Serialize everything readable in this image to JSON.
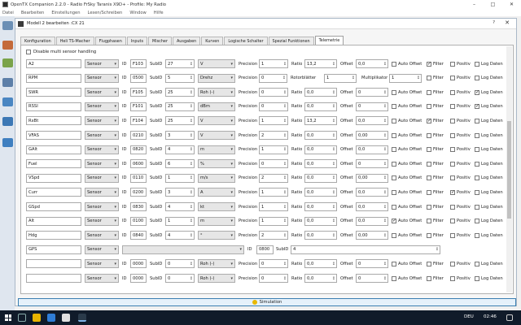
{
  "window": {
    "title": "OpenTX Companion 2.2.0 - Radio FrSky Taranis X9D+ - Profile: My Radio"
  },
  "menu": [
    "Datei",
    "Bearbeiten",
    "Einstellungen",
    "Lesen/Schreiben",
    "Window",
    "Hilfe"
  ],
  "dialog": {
    "title": "Modell 2 bearbeiten :CX 21",
    "help": "?",
    "close": "✕"
  },
  "tabs": [
    "Konfiguration",
    "Heli TS-Macher",
    "Flugphasen",
    "Inputs",
    "Mischer",
    "Ausgaben",
    "Kurven",
    "Logische Schalter",
    "Spezial Funktionen",
    "Telemetrie"
  ],
  "active_tab": "Telemetrie",
  "disable_multi": "Disable multi sensor handling",
  "labels": {
    "id": "ID",
    "subid": "SubID",
    "precision": "Precision",
    "ratio": "Ratio",
    "offset": "Offset",
    "auto_offset": "Auto Offset",
    "filter": "Filter",
    "positiv": "Positiv",
    "log": "Log Daten",
    "rotorblaetter": "Rotorblätter",
    "multiplikator": "Multiplikator"
  },
  "sensors": [
    {
      "name": "A2",
      "type": "Sensor",
      "id": "F103",
      "subid": "27",
      "unit": "V",
      "prec": "1",
      "ratio": "13,2",
      "offset": "0,0",
      "auto": false,
      "filter": true,
      "pos": false,
      "log": false
    },
    {
      "name": "RPM",
      "type": "Sensor",
      "id": "0500",
      "subid": "5",
      "unit": "Drehz",
      "prec": "0",
      "rotor": "1",
      "multi": "1",
      "kind": "rpm"
    },
    {
      "name": "SWR",
      "type": "Sensor",
      "id": "F105",
      "subid": "25",
      "unit": "Roh (-)",
      "prec": "0",
      "ratio": "0,0",
      "offset": "0",
      "auto": false,
      "filter": false,
      "pos": false,
      "log": true
    },
    {
      "name": "RSSI",
      "type": "Sensor",
      "id": "F101",
      "subid": "25",
      "unit": "dBm",
      "prec": "0",
      "ratio": "0,0",
      "offset": "0",
      "auto": false,
      "filter": false,
      "pos": false,
      "log": true
    },
    {
      "name": "RxBt",
      "type": "Sensor",
      "id": "F104",
      "subid": "25",
      "unit": "V",
      "prec": "1",
      "ratio": "13,2",
      "offset": "0,0",
      "auto": false,
      "filter": true,
      "pos": false,
      "log": false
    },
    {
      "name": "VFAS",
      "type": "Sensor",
      "id": "0210",
      "subid": "3",
      "unit": "V",
      "prec": "2",
      "ratio": "0,0",
      "offset": "0,00",
      "auto": false,
      "filter": false,
      "pos": false,
      "log": false
    },
    {
      "name": "GAlt",
      "type": "Sensor",
      "id": "0820",
      "subid": "4",
      "unit": "m",
      "prec": "1",
      "ratio": "0,0",
      "offset": "0,0",
      "auto": false,
      "filter": false,
      "pos": false,
      "log": false
    },
    {
      "name": "Fuel",
      "type": "Sensor",
      "id": "0600",
      "subid": "6",
      "unit": "%",
      "prec": "0",
      "ratio": "0,0",
      "offset": "0",
      "auto": false,
      "filter": false,
      "pos": false,
      "log": false
    },
    {
      "name": "VSpd",
      "type": "Sensor",
      "id": "0110",
      "subid": "1",
      "unit": "m/s",
      "prec": "2",
      "ratio": "0,0",
      "offset": "0,00",
      "auto": false,
      "filter": false,
      "pos": false,
      "log": false
    },
    {
      "name": "Curr",
      "type": "Sensor",
      "id": "0200",
      "subid": "3",
      "unit": "A",
      "prec": "1",
      "ratio": "0,0",
      "offset": "0,0",
      "auto": false,
      "filter": false,
      "pos": true,
      "log": false
    },
    {
      "name": "GSpd",
      "type": "Sensor",
      "id": "0830",
      "subid": "4",
      "unit": "kt",
      "prec": "1",
      "ratio": "0,0",
      "offset": "0,0",
      "auto": false,
      "filter": false,
      "pos": false,
      "log": false
    },
    {
      "name": "Alt",
      "type": "Sensor",
      "id": "0100",
      "subid": "1",
      "unit": "m",
      "prec": "1",
      "ratio": "0,0",
      "offset": "0,0",
      "auto": true,
      "filter": false,
      "pos": false,
      "log": false
    },
    {
      "name": "Hdg",
      "type": "Sensor",
      "id": "0840",
      "subid": "4",
      "unit": "°",
      "prec": "2",
      "ratio": "0,0",
      "offset": "0,00",
      "auto": false,
      "filter": false,
      "pos": false,
      "log": false
    },
    {
      "name": "GPS",
      "type": "Sensor",
      "id": "0800",
      "subid": "4",
      "kind": "gps"
    },
    {
      "name": "",
      "type": "Sensor",
      "id": "0000",
      "subid": "0",
      "unit": "Roh (-)",
      "prec": "0",
      "ratio": "0,0",
      "offset": "0",
      "auto": false,
      "filter": false,
      "pos": false,
      "log": false
    },
    {
      "name": "",
      "type": "Sensor",
      "id": "0000",
      "subid": "0",
      "unit": "Roh (-)",
      "prec": "0",
      "ratio": "0,0",
      "offset": "0",
      "auto": false,
      "filter": false,
      "pos": false,
      "log": false
    }
  ],
  "simulation": "Simulation",
  "taskbar": {
    "time": "02:46",
    "lang": "DEU"
  }
}
